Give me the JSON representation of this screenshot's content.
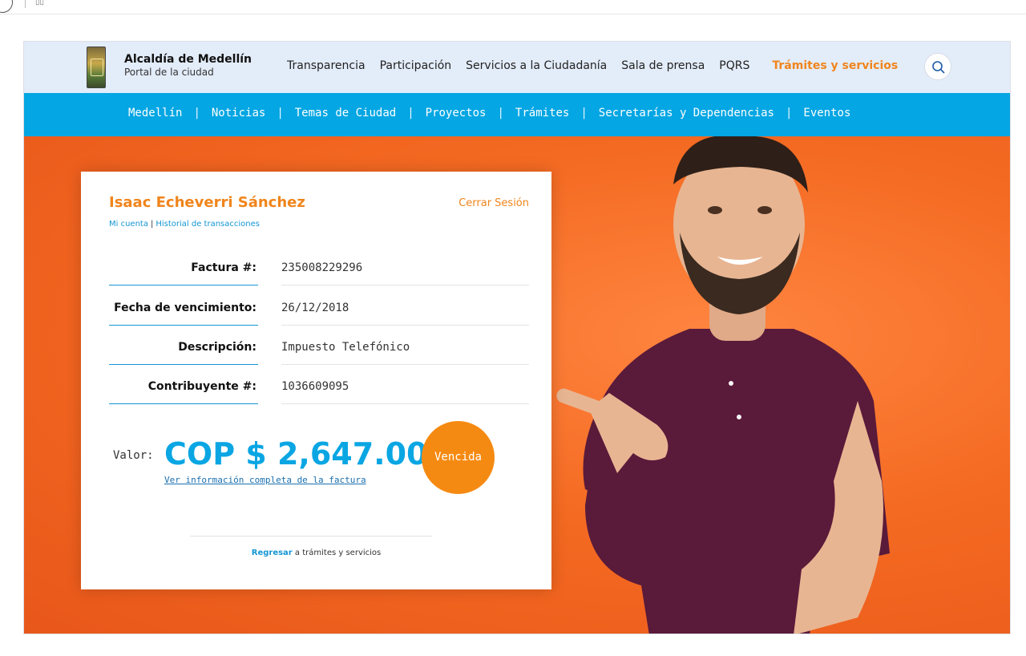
{
  "browser": {
    "glyph": "▯▯"
  },
  "header": {
    "brand_name": "Alcaldía de Medellín",
    "brand_sub": "Portal de la ciudad",
    "nav": [
      "Transparencia",
      "Participación",
      "Servicios a la Ciudadanía",
      "Sala de prensa",
      "PQRS"
    ],
    "nav_active": "Trámites y servicios"
  },
  "subnav": [
    "Medellín",
    "Noticias",
    "Temas de Ciudad",
    "Proyectos",
    "Trámites",
    "Secretarías y Dependencias",
    "Eventos"
  ],
  "card": {
    "user_name": "Isaac Echeverri Sánchez",
    "logout": "Cerrar Sesión",
    "my_account": "Mi cuenta",
    "separator": "|",
    "history": "Historial de transacciones",
    "rows": [
      {
        "label": "Factura #:",
        "value": "235008229296"
      },
      {
        "label": "Fecha de vencimiento:",
        "value": "26/12/2018"
      },
      {
        "label": "Descripción:",
        "value": "Impuesto Telefónico"
      },
      {
        "label": "Contribuyente #:",
        "value": "1036609095"
      }
    ],
    "valor_label": "Valor:",
    "amount": "COP $ 2,647.00",
    "full_info_link": "Ver información completa de la factura",
    "status": "Vencida",
    "back_link": "Regresar",
    "back_text": " a trámites y servicios"
  },
  "colors": {
    "accent": "#f0851c",
    "blue": "#04a6e3",
    "amount": "#0aa6e3"
  }
}
